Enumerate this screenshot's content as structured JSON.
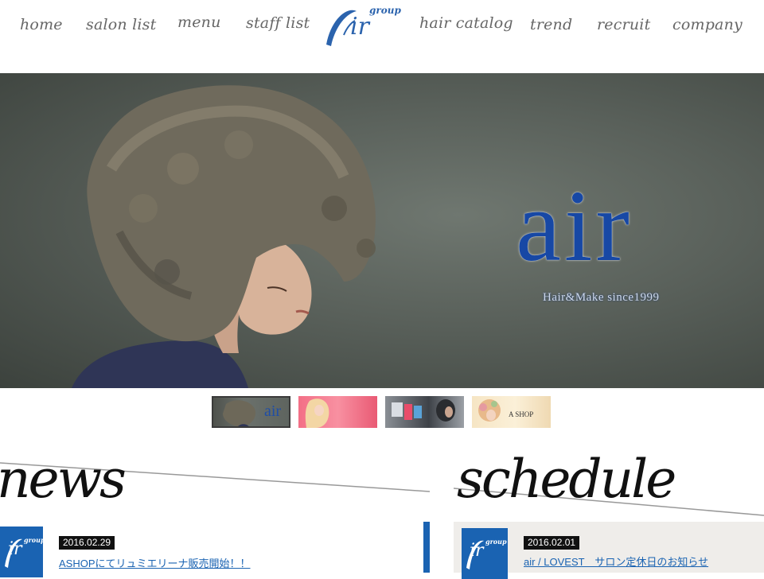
{
  "nav": {
    "items": [
      "home",
      "salon list",
      "menu",
      "staff list",
      "hair catalog",
      "trend",
      "recruit",
      "company"
    ],
    "logo": {
      "main": "ir",
      "sub": "group"
    }
  },
  "hero": {
    "brand": "air",
    "tagline": "Hair&Make since1999"
  },
  "thumbnails": [
    {
      "label": "air"
    },
    {
      "label": ""
    },
    {
      "label": ""
    },
    {
      "label": "A SHOP"
    }
  ],
  "news": {
    "title": "news",
    "items": [
      {
        "logo_main": "ir",
        "logo_sub": "group",
        "date": "2016.02.29",
        "text": "ASHOPにてリュミエリーナ販売開始！！"
      }
    ]
  },
  "schedule": {
    "title": "schedule",
    "items": [
      {
        "logo_main": "ir",
        "logo_sub": "group",
        "date": "2016.02.01",
        "text": "air / LOVEST　サロン定休日のお知らせ"
      }
    ]
  },
  "colors": {
    "brand_blue": "#1a63b2",
    "hero_logo_blue": "#1748a5",
    "nav_text": "#666666"
  }
}
